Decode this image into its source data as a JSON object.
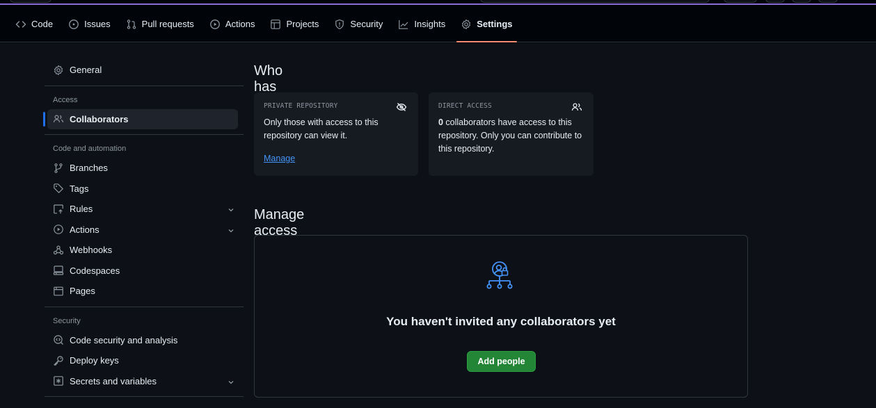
{
  "nav": {
    "tabs": [
      {
        "label": "Code",
        "icon": "code-icon"
      },
      {
        "label": "Issues",
        "icon": "issue-opened-icon"
      },
      {
        "label": "Pull requests",
        "icon": "git-pull-request-icon"
      },
      {
        "label": "Actions",
        "icon": "play-icon"
      },
      {
        "label": "Projects",
        "icon": "table-icon"
      },
      {
        "label": "Security",
        "icon": "shield-icon"
      },
      {
        "label": "Insights",
        "icon": "graph-icon"
      },
      {
        "label": "Settings",
        "icon": "gear-icon",
        "active": true
      }
    ]
  },
  "sidebar": {
    "general": "General",
    "access_heading": "Access",
    "collaborators": "Collaborators",
    "code_heading": "Code and automation",
    "branches": "Branches",
    "tags": "Tags",
    "rules": "Rules",
    "actions": "Actions",
    "webhooks": "Webhooks",
    "codespaces": "Codespaces",
    "pages": "Pages",
    "security_heading": "Security",
    "code_security": "Code security and analysis",
    "deploy_keys": "Deploy keys",
    "secrets": "Secrets and variables"
  },
  "main": {
    "who_title": "Who has access",
    "private_card": {
      "caption": "PRIVATE REPOSITORY",
      "text": "Only those with access to this repository can view it.",
      "link": "Manage"
    },
    "direct_card": {
      "caption": "DIRECT ACCESS",
      "count": "0",
      "text": " collaborators have access to this repository. Only you can contribute to this repository."
    },
    "manage_title": "Manage access",
    "empty_title": "You haven't invited any collaborators yet",
    "add_button": "Add people"
  },
  "colors": {
    "background": "#0d1117",
    "nav_background": "#010409",
    "border": "#30363d",
    "accent_blue": "#4493f8",
    "active_tab_underline": "#fd8c73",
    "button_green": "#238636"
  }
}
